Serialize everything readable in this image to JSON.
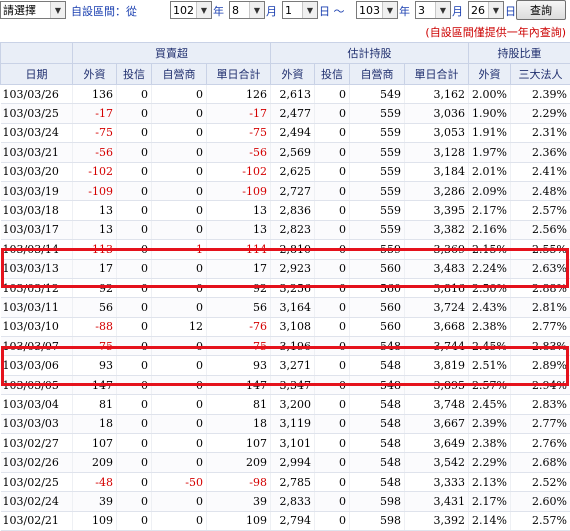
{
  "filter": {
    "mode": "請選擇",
    "range_label": "自設區間：從",
    "from_year": "102",
    "year_unit": "年",
    "from_month": "8",
    "month_unit": "月",
    "from_day": "1",
    "day_unit": "日 ～",
    "to_year": "103",
    "to_month": "3",
    "to_day": "26",
    "day_unit_end": "日",
    "query_button": "查詢"
  },
  "note": "(自設區間僅提供一年內查詢)",
  "headers": {
    "group1": "買賣超",
    "group2": "估計持股",
    "group3": "持股比重",
    "columns": [
      "日期",
      "外資",
      "投信",
      "自營商",
      "單日合計",
      "外資",
      "投信",
      "自營商",
      "單日合計",
      "外資",
      "三大法人"
    ]
  },
  "rows": [
    [
      "103/03/26",
      "136",
      "0",
      "0",
      "126",
      "2,613",
      "0",
      "549",
      "3,162",
      "2.00%",
      "2.39%"
    ],
    [
      "103/03/25",
      "-17",
      "0",
      "0",
      "-17",
      "2,477",
      "0",
      "559",
      "3,036",
      "1.90%",
      "2.29%"
    ],
    [
      "103/03/24",
      "-75",
      "0",
      "0",
      "-75",
      "2,494",
      "0",
      "559",
      "3,053",
      "1.91%",
      "2.31%"
    ],
    [
      "103/03/21",
      "-56",
      "0",
      "0",
      "-56",
      "2,569",
      "0",
      "559",
      "3,128",
      "1.97%",
      "2.36%"
    ],
    [
      "103/03/20",
      "-102",
      "0",
      "0",
      "-102",
      "2,625",
      "0",
      "559",
      "3,184",
      "2.01%",
      "2.41%"
    ],
    [
      "103/03/19",
      "-109",
      "0",
      "0",
      "-109",
      "2,727",
      "0",
      "559",
      "3,286",
      "2.09%",
      "2.48%"
    ],
    [
      "103/03/18",
      "13",
      "0",
      "0",
      "13",
      "2,836",
      "0",
      "559",
      "3,395",
      "2.17%",
      "2.57%"
    ],
    [
      "103/03/17",
      "13",
      "0",
      "0",
      "13",
      "2,823",
      "0",
      "559",
      "3,382",
      "2.16%",
      "2.56%"
    ],
    [
      "103/03/14",
      "-113",
      "0",
      "-1",
      "-114",
      "2,810",
      "0",
      "559",
      "3,369",
      "2.15%",
      "2.55%"
    ],
    [
      "103/03/13",
      "17",
      "0",
      "0",
      "17",
      "2,923",
      "0",
      "560",
      "3,483",
      "2.24%",
      "2.63%"
    ],
    [
      "103/03/12",
      "92",
      "0",
      "0",
      "92",
      "3,256",
      "0",
      "560",
      "3,816",
      "2.50%",
      "2.88%"
    ],
    [
      "103/03/11",
      "56",
      "0",
      "0",
      "56",
      "3,164",
      "0",
      "560",
      "3,724",
      "2.43%",
      "2.81%"
    ],
    [
      "103/03/10",
      "-88",
      "0",
      "12",
      "-76",
      "3,108",
      "0",
      "560",
      "3,668",
      "2.38%",
      "2.77%"
    ],
    [
      "103/03/07",
      "-75",
      "0",
      "0",
      "-75",
      "3,196",
      "0",
      "548",
      "3,744",
      "2.45%",
      "2.83%"
    ],
    [
      "103/03/06",
      "93",
      "0",
      "0",
      "93",
      "3,271",
      "0",
      "548",
      "3,819",
      "2.51%",
      "2.89%"
    ],
    [
      "103/03/05",
      "147",
      "0",
      "0",
      "147",
      "3,347",
      "0",
      "548",
      "3,895",
      "2.57%",
      "2.94%"
    ],
    [
      "103/03/04",
      "81",
      "0",
      "0",
      "81",
      "3,200",
      "0",
      "548",
      "3,748",
      "2.45%",
      "2.83%"
    ],
    [
      "103/03/03",
      "18",
      "0",
      "0",
      "18",
      "3,119",
      "0",
      "548",
      "3,667",
      "2.39%",
      "2.77%"
    ],
    [
      "103/02/27",
      "107",
      "0",
      "0",
      "107",
      "3,101",
      "0",
      "548",
      "3,649",
      "2.38%",
      "2.76%"
    ],
    [
      "103/02/26",
      "209",
      "0",
      "0",
      "209",
      "2,994",
      "0",
      "548",
      "3,542",
      "2.29%",
      "2.68%"
    ],
    [
      "103/02/25",
      "-48",
      "0",
      "-50",
      "-98",
      "2,785",
      "0",
      "548",
      "3,333",
      "2.13%",
      "2.52%"
    ],
    [
      "103/02/24",
      "39",
      "0",
      "0",
      "39",
      "2,833",
      "0",
      "598",
      "3,431",
      "2.17%",
      "2.60%"
    ],
    [
      "103/02/21",
      "109",
      "0",
      "0",
      "109",
      "2,794",
      "0",
      "598",
      "3,392",
      "2.14%",
      "2.57%"
    ]
  ],
  "colors": {
    "negative": "#d40000",
    "highlight": "#e5121c",
    "header_text": "#1f2e6e"
  }
}
